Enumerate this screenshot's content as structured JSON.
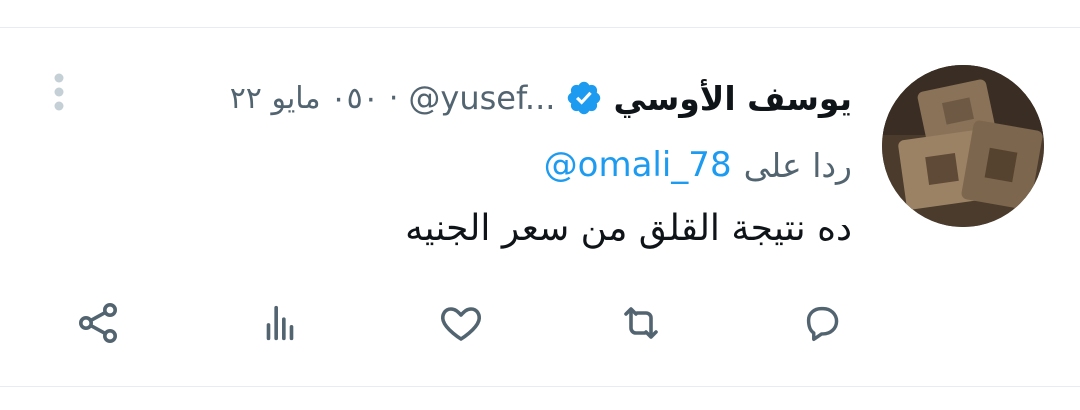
{
  "tweet": {
    "author": {
      "display_name": "يوسف الأوسي",
      "handle": "@yusef...",
      "verified": true
    },
    "separator": "·",
    "time": "٠٥٠",
    "date": "مايو ٢٢",
    "reply_to": {
      "prefix": "ردا على",
      "handle": "@omali_78"
    },
    "text": "ده نتيجة القلق من سعر الجنيه"
  },
  "actions": [
    {
      "name": "reply",
      "icon": "reply-icon"
    },
    {
      "name": "retweet",
      "icon": "retweet-icon"
    },
    {
      "name": "like",
      "icon": "heart-icon"
    },
    {
      "name": "views",
      "icon": "analytics-icon"
    },
    {
      "name": "share",
      "icon": "share-icon"
    }
  ],
  "colors": {
    "text_primary": "#0f1419",
    "text_secondary": "#536471",
    "link": "#1d9bf0",
    "verified": "#1d9bf0",
    "divider": "#e6ecf0"
  }
}
